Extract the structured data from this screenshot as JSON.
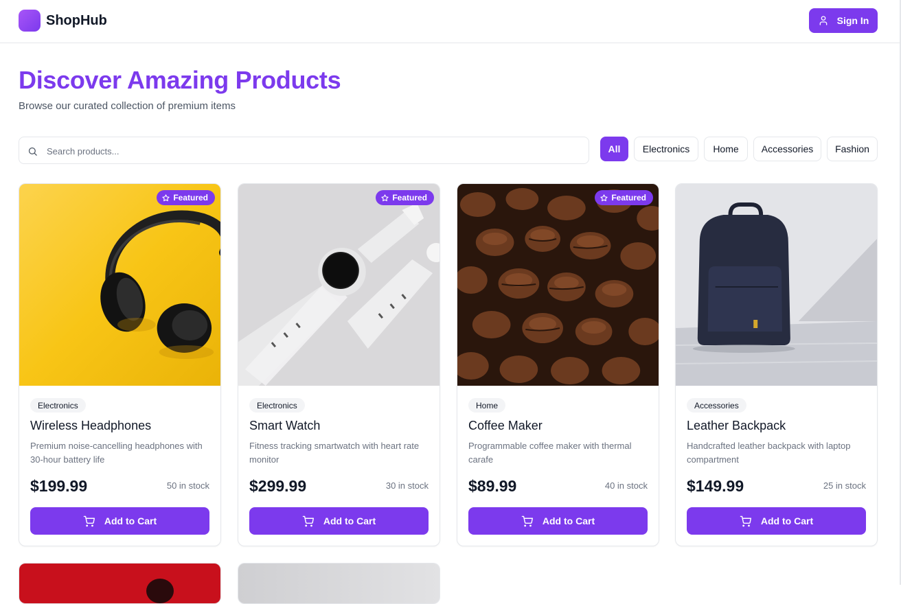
{
  "header": {
    "brand": "ShopHub",
    "signin_label": "Sign In"
  },
  "hero": {
    "title": "Discover Amazing Products",
    "subtitle": "Browse our curated collection of premium items"
  },
  "search": {
    "placeholder": "Search products..."
  },
  "filters": [
    {
      "label": "All",
      "active": true
    },
    {
      "label": "Electronics",
      "active": false
    },
    {
      "label": "Home",
      "active": false
    },
    {
      "label": "Accessories",
      "active": false
    },
    {
      "label": "Fashion",
      "active": false
    }
  ],
  "products": [
    {
      "name": "Wireless Headphones",
      "category": "Electronics",
      "description": "Premium noise-cancelling headphones with 30-hour battery life",
      "price": "$199.99",
      "stock": "50 in stock",
      "featured": "Featured",
      "cart_label": "Add to Cart"
    },
    {
      "name": "Smart Watch",
      "category": "Electronics",
      "description": "Fitness tracking smartwatch with heart rate monitor",
      "price": "$299.99",
      "stock": "30 in stock",
      "featured": "Featured",
      "cart_label": "Add to Cart"
    },
    {
      "name": "Coffee Maker",
      "category": "Home",
      "description": "Programmable coffee maker with thermal carafe",
      "price": "$89.99",
      "stock": "40 in stock",
      "featured": "Featured",
      "cart_label": "Add to Cart"
    },
    {
      "name": "Leather Backpack",
      "category": "Accessories",
      "description": "Handcrafted leather backpack with laptop compartment",
      "price": "$149.99",
      "stock": "25 in stock",
      "featured": "",
      "cart_label": "Add to Cart"
    }
  ],
  "colors": {
    "accent": "#7c3aed",
    "border": "#e5e7eb",
    "muted_text": "#6b7280"
  },
  "icons": {
    "signin": "user-icon",
    "search": "search-icon",
    "badge": "star-icon",
    "cart": "cart-icon"
  }
}
